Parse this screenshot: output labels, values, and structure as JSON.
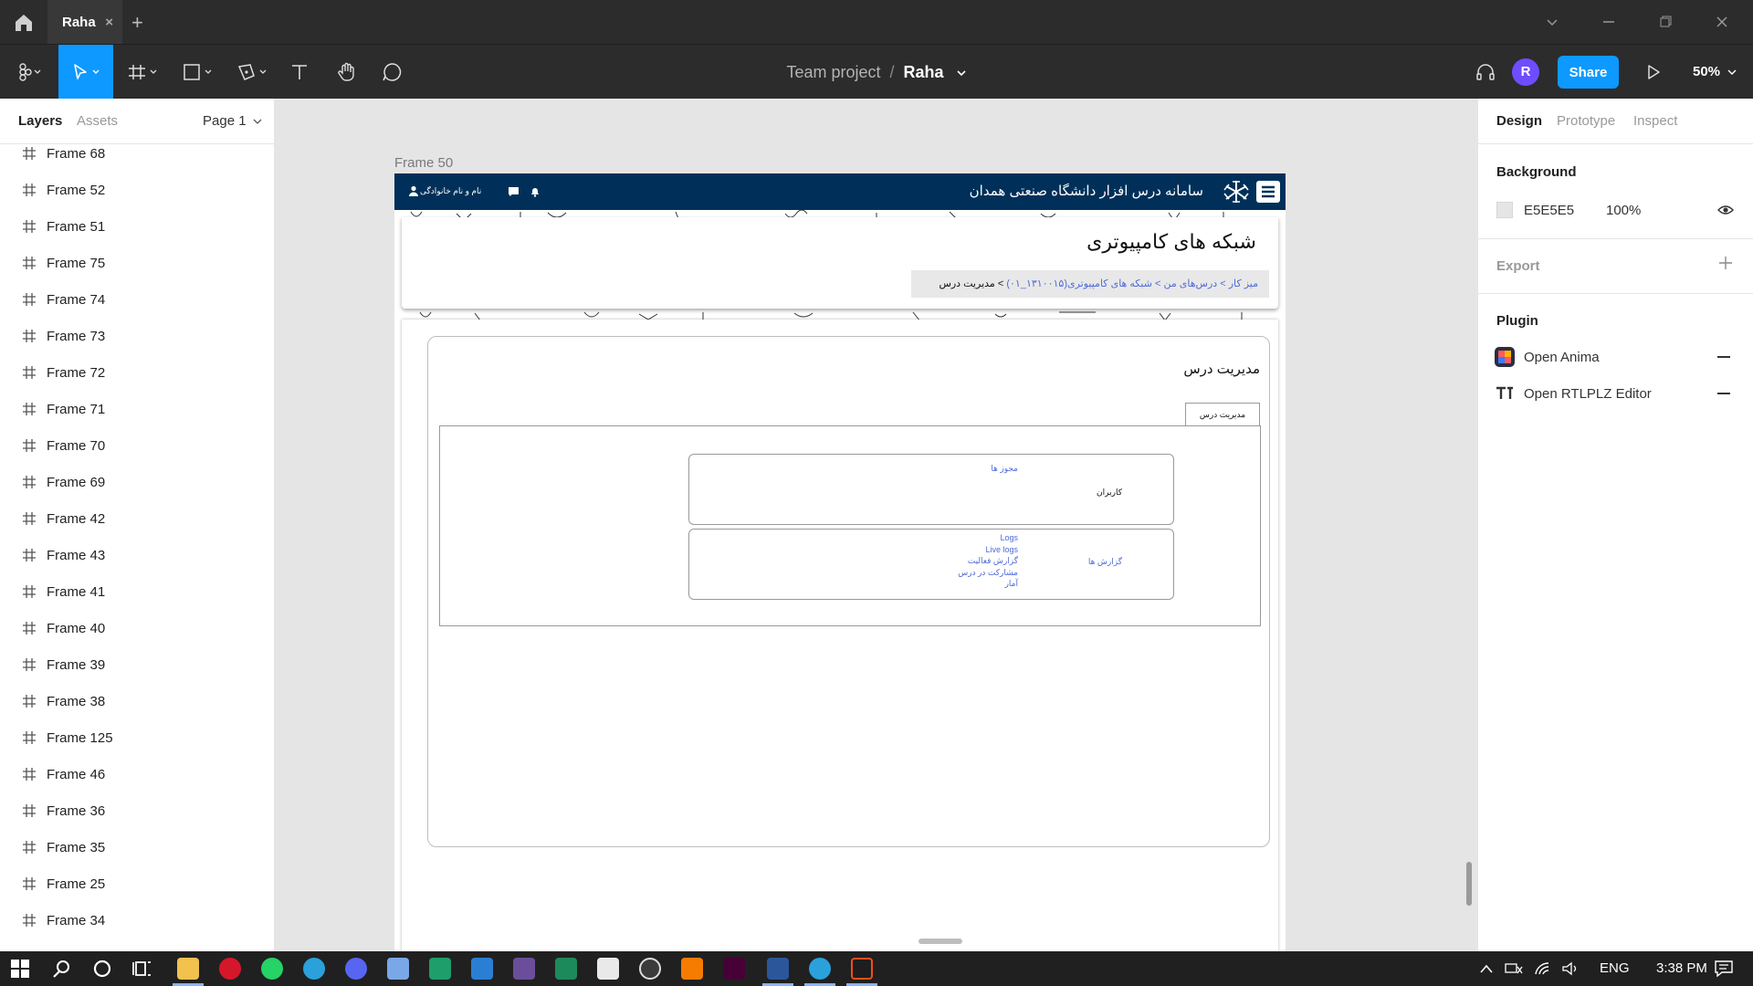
{
  "titlebar": {
    "tab_label": "Raha",
    "close_glyph": "×",
    "new_tab_glyph": "+"
  },
  "toolbar": {
    "project": "Team project",
    "separator": "/",
    "file": "Raha",
    "avatar_initial": "R",
    "share_label": "Share",
    "zoom": "50%"
  },
  "left_panel": {
    "tabs": {
      "layers": "Layers",
      "assets": "Assets"
    },
    "page_label": "Page 1",
    "layers": [
      "Frame 68",
      "Frame 52",
      "Frame 51",
      "Frame 75",
      "Frame 74",
      "Frame 73",
      "Frame 72",
      "Frame 71",
      "Frame 70",
      "Frame 69",
      "Frame 42",
      "Frame 43",
      "Frame 41",
      "Frame 40",
      "Frame 39",
      "Frame 38",
      "Frame 125",
      "Frame 46",
      "Frame 36",
      "Frame 35",
      "Frame 25",
      "Frame 34"
    ]
  },
  "right_panel": {
    "tabs": {
      "design": "Design",
      "prototype": "Prototype",
      "inspect": "Inspect"
    },
    "background_title": "Background",
    "background_hex": "E5E5E5",
    "background_opacity": "100%",
    "export_title": "Export",
    "plugin_title": "Plugin",
    "plugins": [
      "Open Anima",
      "Open RTLPLZ Editor"
    ]
  },
  "canvas": {
    "frame_label": "Frame 50",
    "site_title": "سامانه درس افزار دانشگاه صنعتی همدان",
    "user_name": "نام و نام خانوادگی",
    "course_title": "شبکه های کامپیوتری",
    "breadcrumb": {
      "dashboard": "میز کار",
      "sep1": " > ",
      "my_courses": "درس‌های من",
      "sep2": " >  ",
      "course": "شبکه های کامپیوتری(۱۳۱۰۰۱۵_۰۱)",
      "sep3": "  > ",
      "current": "مدیریت درس"
    },
    "mgmt_title": "مدیریت درس",
    "mgmt_tab": "مدیریت درس",
    "users_box": {
      "label": "کاربران",
      "link": "مجوز ها"
    },
    "reports_box": {
      "label": "گزارش ها",
      "links": [
        "Logs",
        "Live logs",
        "گزارش فعالیت",
        "مشارکت در درس",
        "آمار"
      ]
    },
    "help_glyph": "?"
  },
  "taskbar": {
    "lang": "ENG",
    "time": "3:38 PM"
  },
  "colors": {
    "accent": "#0d99ff",
    "site_header": "#003059",
    "link": "#4f6bd8",
    "avatar": "#6d4dff"
  }
}
